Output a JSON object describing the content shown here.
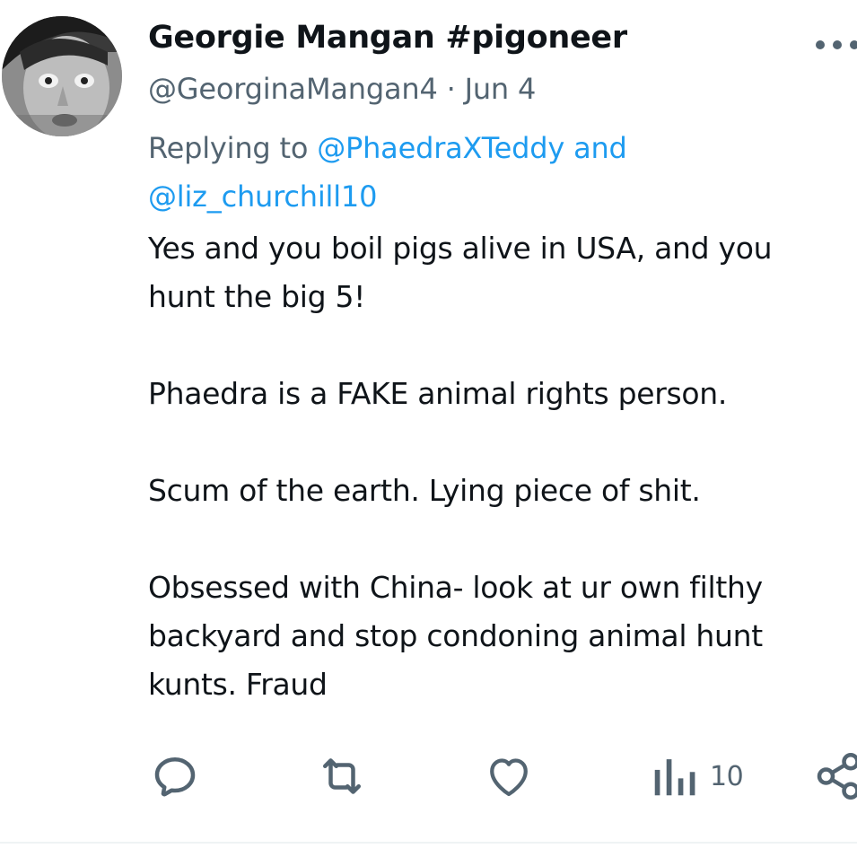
{
  "tweet": {
    "display_name": "Georgie Mangan #pigoneer",
    "handle": "@GeorginaMangan4",
    "separator": "·",
    "date": "Jun 4",
    "replying_prefix": "Replying to",
    "reply_mention_1": "@PhaedraXTeddy",
    "reply_joiner": "and",
    "reply_mention_2": "@liz_churchill10",
    "body": {
      "line_1": "Yes and you boil pigs alive in USA, and you",
      "line_2": "hunt the big 5!",
      "line_3": "Phaedra is a FAKE animal rights person.",
      "line_4": "Scum of the earth. Lying piece of shit.",
      "line_5": "Obsessed with China- look at ur own filthy",
      "line_6": "backyard and stop condoning animal hunt",
      "line_7": "kunts. Fraud"
    },
    "actions": {
      "reply_icon": "reply-icon",
      "retweet_icon": "retweet-icon",
      "like_icon": "heart-icon",
      "views_icon": "analytics-icon",
      "views_count": "10",
      "share_icon": "share-icon"
    },
    "colors": {
      "text": "#0f1419",
      "secondary": "#536471",
      "link": "#1d9bf0"
    }
  }
}
